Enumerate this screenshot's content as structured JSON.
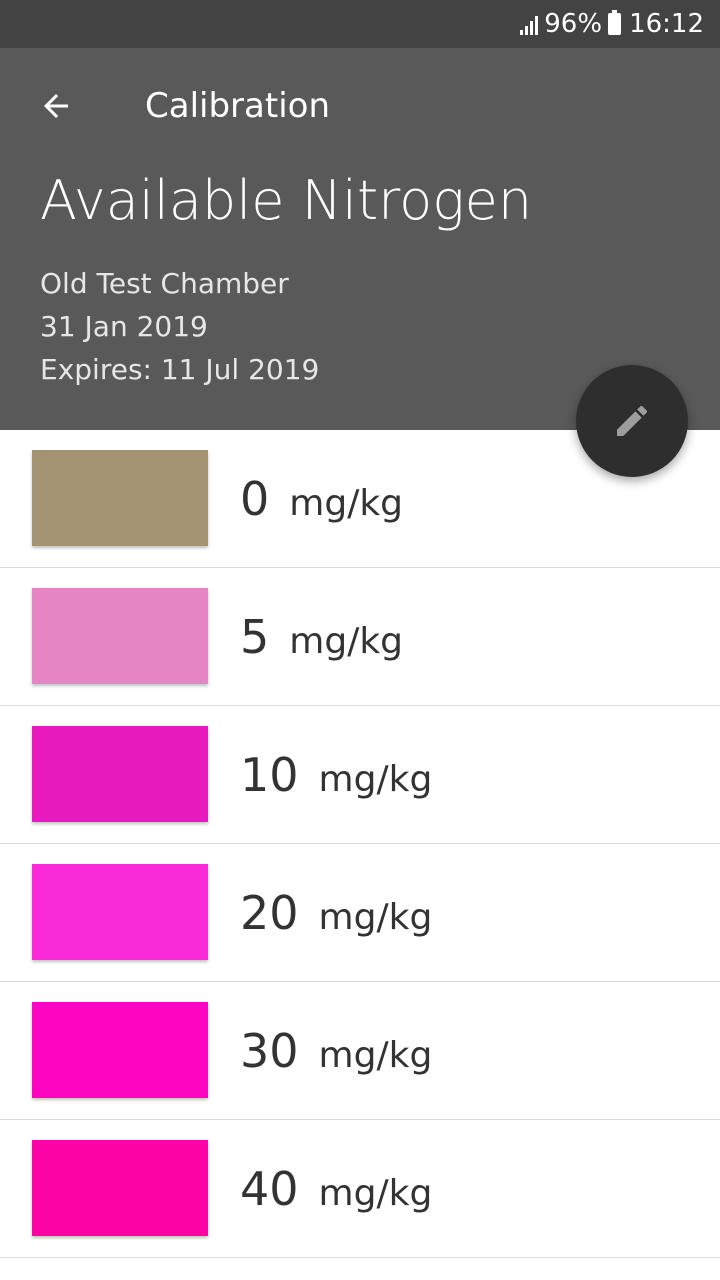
{
  "status_bar": {
    "battery": "96%",
    "time": "16:12"
  },
  "toolbar": {
    "title": "Calibration",
    "back_icon": "arrow-left-icon"
  },
  "header": {
    "title": "Available Nitrogen",
    "subtitle": "Old Test Chamber",
    "date": "31 Jan 2019",
    "expires": "Expires: 11 Jul 2019"
  },
  "fab": {
    "icon": "pencil-icon"
  },
  "calibrations": [
    {
      "value": "0",
      "unit": "mg/kg",
      "color": "#a39372"
    },
    {
      "value": "5",
      "unit": "mg/kg",
      "color": "#e685c3"
    },
    {
      "value": "10",
      "unit": "mg/kg",
      "color": "#e819bd"
    },
    {
      "value": "20",
      "unit": "mg/kg",
      "color": "#fb2ad8"
    },
    {
      "value": "30",
      "unit": "mg/kg",
      "color": "#fd04c1"
    },
    {
      "value": "40",
      "unit": "mg/kg",
      "color": "#fd04a7"
    }
  ]
}
